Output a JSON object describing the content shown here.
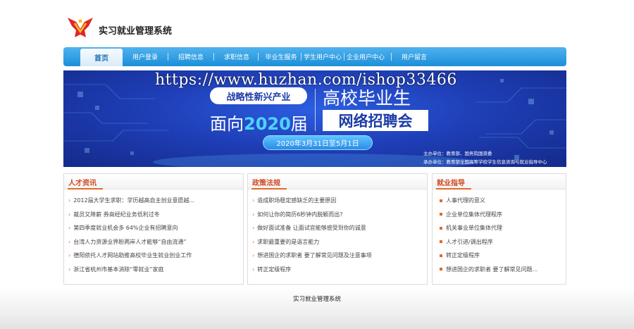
{
  "header": {
    "site_title": "实习就业管理系统"
  },
  "nav": {
    "items": [
      {
        "label": "首页",
        "active": true
      },
      {
        "label": "用户登录"
      },
      {
        "label": "招聘信息"
      },
      {
        "label": "求职信息"
      },
      {
        "label": "毕业生服务"
      },
      {
        "label": "学生用户中心"
      },
      {
        "label": "企业用户中心"
      },
      {
        "label": "用户留言"
      }
    ]
  },
  "banner": {
    "watermark": "https://www.huzhan.com/ishop33466",
    "tag": "战略性新兴产业",
    "title_line1": "高校毕业生",
    "face_prefix": "面向",
    "face_year": "2020",
    "face_suffix": "届",
    "title_line2": "网络招聘会",
    "date": "2020年3月31日至5月1日",
    "organizer": "主办单位：教育部、国务院国资委",
    "co_organizer": "承办单位：教育部全国高等学校学生信息咨询与就业指导中心"
  },
  "panels": {
    "talent": {
      "title": "人才资讯",
      "items": [
        "2012届大学生求职：学历越高自主创业意愿越...",
        "裁员又降薪 券商经纪业务低利过冬",
        "第四季度就业机会多 64%企业有招聘意向",
        "台湾人力资源业界盼两岸人才能够“自由流通”",
        "德阳依托人才网站助推高校毕业生就业创业工作",
        "浙江省杭州市基本消除“零就业”家庭"
      ]
    },
    "policy": {
      "title": "政策法规",
      "items": [
        "造成职场稳定感缺乏的主要原因",
        "如何让你的简历6秒钟内脱颖而出?",
        "做好面试准备 让面试官能够感受到你的诚意",
        "求职最重要的是语言能力",
        "想进国企的求职者 要了解常见问题及注意事项",
        "转正定级程序"
      ]
    },
    "guide": {
      "title": "就业指导",
      "items": [
        "人事代理的意义",
        "企业单位集体代理程序",
        "机关事业单位集体代理",
        "人才引进/调出程序",
        "转正定级程序",
        "想进国企的求职者 要了解常见问题..."
      ]
    }
  },
  "footer": {
    "text": "实习就业管理系统"
  },
  "colors": {
    "nav_blue": "#1c8fd8",
    "accent_orange": "#e06a2a",
    "panel_title": "#d2461e",
    "banner_blue": "#1f3fb8"
  }
}
